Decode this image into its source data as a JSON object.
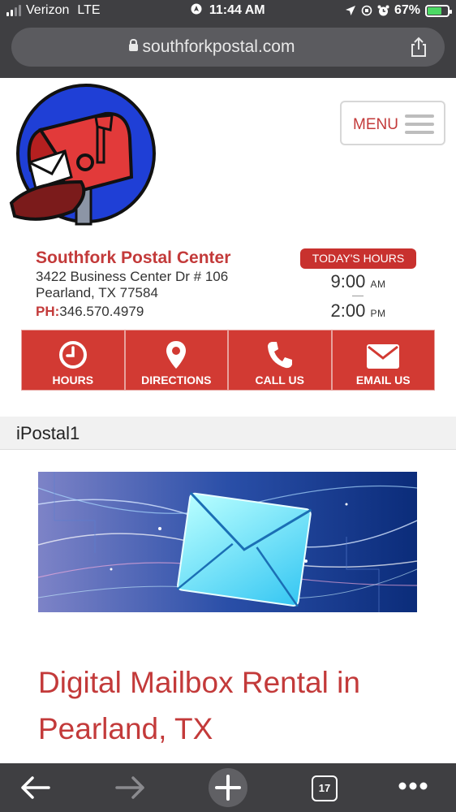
{
  "status_bar": {
    "carrier": "Verizon",
    "network": "LTE",
    "time": "11:44 AM",
    "battery": "67%",
    "battery_level": 0.67
  },
  "browser": {
    "url": "southforkpostal.com",
    "tab_count": "17"
  },
  "header": {
    "menu_label": "MENU"
  },
  "business": {
    "name": "Southfork Postal Center",
    "address_line1": "3422 Business Center Dr # 106",
    "address_line2": "Pearland, TX 77584",
    "phone_label": "PH:",
    "phone": "346.570.4979"
  },
  "hours": {
    "badge": "TODAY'S HOURS",
    "open_time": "9:00",
    "open_ampm": "AM",
    "close_time": "2:00",
    "close_ampm": "PM"
  },
  "actions": [
    {
      "label": "HOURS",
      "icon": "clock-icon"
    },
    {
      "label": "DIRECTIONS",
      "icon": "map-pin-icon"
    },
    {
      "label": "CALL US",
      "icon": "phone-icon"
    },
    {
      "label": "EMAIL US",
      "icon": "envelope-icon"
    }
  ],
  "page": {
    "title": "iPostal1",
    "headline": "Digital Mailbox Rental in Pearland, TX"
  },
  "colors": {
    "brand_red": "#c33a3a",
    "button_red": "#d23a33",
    "browser_chrome": "#3f3f42"
  }
}
